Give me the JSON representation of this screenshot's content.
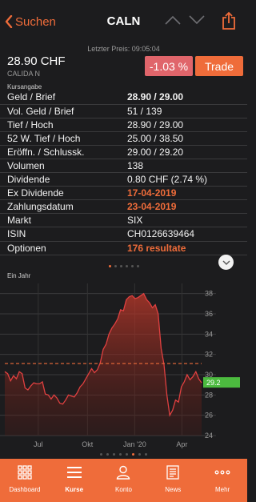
{
  "header": {
    "back_label": "Suchen",
    "title": "CALN",
    "icons": [
      "chevron-left-icon",
      "arrow-up-icon",
      "arrow-down-icon",
      "share-icon"
    ]
  },
  "quote": {
    "last_price_label": "Letzter Preis: 09:05:04",
    "price": "28.90 CHF",
    "name": "CALIDA N",
    "change": "-1.03 %",
    "trade_label": "Trade",
    "kursangabe_label": "Kursangabe"
  },
  "info_rows": [
    {
      "label": "Geld / Brief",
      "value": "28.90 / 29.00",
      "style": "bold"
    },
    {
      "label": "Vol. Geld / Brief",
      "value": "51 / 139",
      "style": "normal"
    },
    {
      "label": "Tief / Hoch",
      "value": "28.90 / 29.00",
      "style": "normal"
    },
    {
      "label": "52 W. Tief / Hoch",
      "value": "25.00 / 38.50",
      "style": "normal"
    },
    {
      "label": "Eröffn. / Schlussk.",
      "value": "29.00 / 29.20",
      "style": "normal"
    },
    {
      "label": "Volumen",
      "value": "138",
      "style": "normal"
    },
    {
      "label": "Dividende",
      "value": "0.80 CHF (2.74 %)",
      "style": "normal"
    },
    {
      "label": "Ex Dividende",
      "value": "17-04-2019",
      "style": "orange"
    },
    {
      "label": "Zahlungsdatum",
      "value": "23-04-2019",
      "style": "orange"
    },
    {
      "label": "Markt",
      "value": "SIX",
      "style": "normal"
    },
    {
      "label": "ISIN",
      "value": "CH0126639464",
      "style": "normal"
    },
    {
      "label": "Optionen",
      "value": "176 resultate",
      "style": "orange"
    }
  ],
  "page_dots_top": {
    "count": 6,
    "active": 0
  },
  "page_dots_bottom": {
    "count": 8,
    "active": 5
  },
  "chart_label": "Ein Jahr",
  "chart_data": {
    "type": "area",
    "title": "Ein Jahr",
    "y_ticks": [
      24,
      26,
      28,
      30,
      32,
      34,
      36,
      38
    ],
    "ylim": [
      24,
      39
    ],
    "x_ticks": [
      "Jul",
      "Okt",
      "Jan '20",
      "Apr"
    ],
    "current_value": "29.2",
    "reference_line": 31.1,
    "series": [
      {
        "values": [
          30.3,
          30.1,
          29.4,
          29.9,
          29.6,
          30.3,
          30.1,
          28.7,
          28.5,
          28.9,
          29.2,
          29.1,
          29.1,
          29.3,
          28.1,
          28.0,
          27.6,
          28.0,
          27.7,
          27.2,
          27.1,
          27.5,
          28.0,
          27.9,
          27.8,
          28.2,
          28.8,
          29.1,
          29.6,
          30.1,
          30.6,
          30.2,
          30.5,
          31.2,
          32.5,
          33.0,
          34.0,
          34.6,
          35.0,
          35.5,
          36.4,
          36.3,
          37.4,
          37.7,
          37.8,
          37.5,
          37.6,
          37.8,
          38.0,
          37.4,
          37.1,
          36.6,
          36.9,
          36.0,
          32.6,
          31.0,
          28.0,
          26.0,
          26.5,
          27.5,
          27.3,
          28.8,
          29.3,
          30.0,
          29.5,
          29.8,
          30.3,
          29.6,
          29.2
        ]
      }
    ]
  },
  "colors": {
    "accent": "#ef6c3a",
    "negative": "#e0656b",
    "positive": "#4cbb3f",
    "line": "#e04040"
  },
  "tabs": [
    {
      "label": "Dashboard",
      "icon": "dashboard-grid-icon",
      "active": false
    },
    {
      "label": "Kurse",
      "icon": "list-icon",
      "active": true
    },
    {
      "label": "Konto",
      "icon": "person-icon",
      "active": false
    },
    {
      "label": "News",
      "icon": "newspaper-icon",
      "active": false
    },
    {
      "label": "Mehr",
      "icon": "more-dots-icon",
      "active": false
    }
  ]
}
